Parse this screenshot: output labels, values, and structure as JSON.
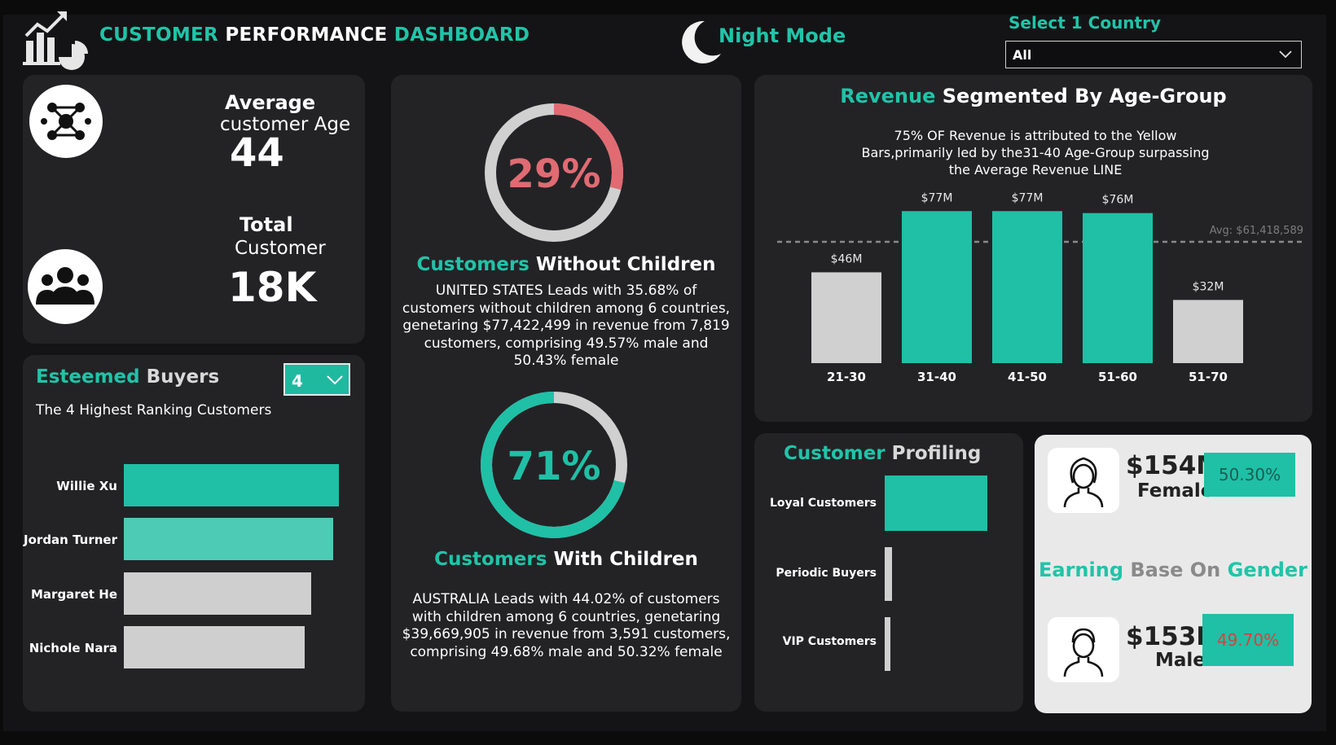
{
  "header": {
    "title_part1": "CUSTOMER",
    "title_part2": "PERFORMANCE",
    "title_part3": "DASHBOARD",
    "mode_label": "Night Mode",
    "country_label": "Select 1 Country",
    "country_value": "All"
  },
  "kpi": {
    "avg_label_1": "Average",
    "avg_label_2": "customer Age",
    "avg_value": "44",
    "total_label_1": "Total",
    "total_label_2": "Customer",
    "total_value": "18K"
  },
  "buyers": {
    "title_1": "Esteemed",
    "title_2": "Buyers",
    "subtitle": "The 4 Highest Ranking Customers",
    "top_n": "4",
    "items": [
      {
        "name": "Willie Xu",
        "rank_fraction": 1.0,
        "color": "#1fc0a6"
      },
      {
        "name": "Jordan Turner",
        "rank_fraction": 0.975,
        "color": "#4ecbb4"
      },
      {
        "name": "Margaret He",
        "rank_fraction": 0.87,
        "color": "#cfcfcf"
      },
      {
        "name": "Nichole Nara",
        "rank_fraction": 0.84,
        "color": "#cfcfcf"
      }
    ]
  },
  "children": {
    "without_pct": "29%",
    "without_value": 0.29,
    "without_title_1": "Customers",
    "without_title_2": "Without Children",
    "without_desc": "UNITED STATES Leads with 35.68% of customers without children among 6 countries, genetaring $77,422,499 in revenue from 7,819 customers, comprising 49.57% male and 50.43% female",
    "with_pct": "71%",
    "with_value": 0.71,
    "with_title_1": "Customers",
    "with_title_2": "With Children",
    "with_desc": "AUSTRALIA Leads with 44.02% of customers with children among 6 countries, genetaring $39,669,905 in revenue from 3,591 customers, comprising 49.68% male and 50.32% female",
    "colors": {
      "accent_red": "#e06b73",
      "accent_teal": "#1fc0a6",
      "track": "#d0d0d0"
    }
  },
  "revenue": {
    "title_1": "Revenue",
    "title_2": "Segmented By Age-Group",
    "subtitle": "75% OF Revenue is attributed to the Yellow Bars,primarily led by the31-40 Age-Group surpassing the Average Revenue LINE"
  },
  "chart_data": {
    "type": "bar",
    "categories": [
      "21-30",
      "31-40",
      "41-50",
      "51-60",
      "51-70"
    ],
    "values": [
      46,
      77,
      77,
      76,
      32
    ],
    "labels": [
      "$46M",
      "$77M",
      "$77M",
      "$76M",
      "$32M"
    ],
    "colors": [
      "#d0d0d0",
      "#1fc0a6",
      "#1fc0a6",
      "#1fc0a6",
      "#d0d0d0"
    ],
    "avg_value": 61.418589,
    "avg_label": "Avg: $61,418,589",
    "ylim": [
      0,
      80
    ]
  },
  "profiling": {
    "title_1": "Customer",
    "title_2": "Profiling",
    "items": [
      {
        "name": "Loyal Customers",
        "value": 1.0,
        "color": "#1fc0a6"
      },
      {
        "name": "Periodic Buyers",
        "value": 0.07,
        "color": "#cfcfcf"
      },
      {
        "name": "VIP Customers",
        "value": 0.05,
        "color": "#cfcfcf"
      }
    ]
  },
  "gender": {
    "title_1": "Earning",
    "title_2": "Base On",
    "title_3": "Gender",
    "female_value": "$154M",
    "female_label": "Female",
    "female_pct": "50.30%",
    "male_value": "$153M",
    "male_label": "Male",
    "male_pct": "49.70%",
    "female_pct_color": "#1a5e52",
    "male_pct_color": "#d9413c"
  }
}
